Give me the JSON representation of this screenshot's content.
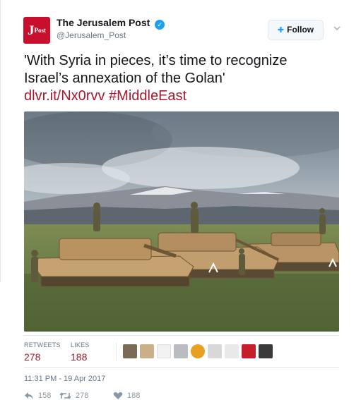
{
  "account": {
    "name": "The Jerusalem Post",
    "handle": "@Jerusalem_Post",
    "avatar_letter": "J",
    "avatar_small": "Post",
    "brand_color": "#c8102e",
    "verified_icon": "verified-badge-icon"
  },
  "follow_button": {
    "label": "Follow",
    "icon": "add-user-icon"
  },
  "tweet": {
    "line1": "'With Syria in pieces, it’s time to recognize",
    "line2": "Israel’s annexation of the Golan'",
    "link": "dlvr.it/Nx0rvv",
    "hashtag": "#MiddleEast",
    "link_color": "#a5192e"
  },
  "stats": {
    "retweets_label": "RETWEETS",
    "retweets": "278",
    "likes_label": "LIKES",
    "likes": "188"
  },
  "timestamp": "11:31 PM - 19 Apr 2017",
  "actions": {
    "reply_count": "158",
    "retweet_count": "278",
    "like_count": "188"
  }
}
